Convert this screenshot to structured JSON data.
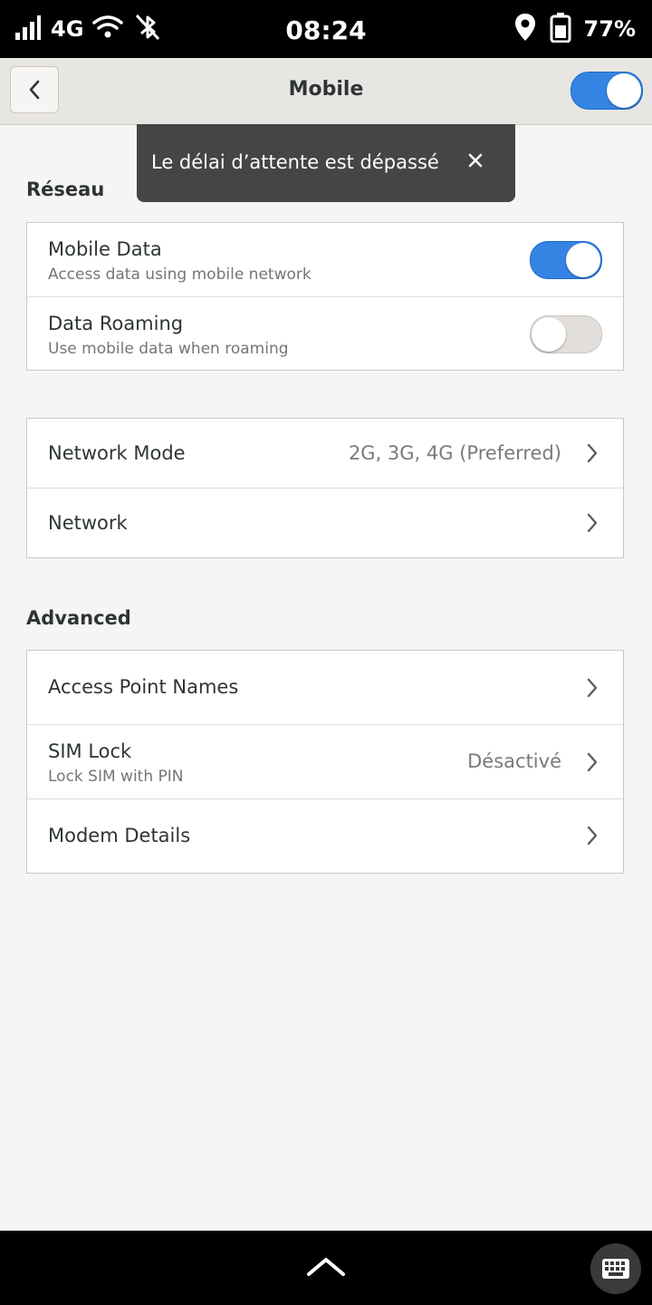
{
  "statusbar": {
    "network_type": "4G",
    "clock": "08:24",
    "battery_percent": "77%",
    "signal_icon": "signal-bars-icon",
    "wifi_icon": "wifi-icon",
    "bluetooth_icon": "bluetooth-disabled-icon",
    "location_icon": "location-pin-icon",
    "battery_icon": "battery-charging-icon"
  },
  "header": {
    "title": "Mobile",
    "back_icon": "chevron-left-icon",
    "master_switch_on": true
  },
  "toast": {
    "message": "Le délai d’attente est dépassé",
    "close_icon": "close-icon"
  },
  "sections": {
    "network_title": "Réseau",
    "advanced_title": "Advanced"
  },
  "network_list": {
    "mobile_data": {
      "title": "Mobile Data",
      "subtitle": "Access data using mobile network",
      "enabled": true
    },
    "data_roaming": {
      "title": "Data Roaming",
      "subtitle": "Use mobile data when roaming",
      "enabled": false
    }
  },
  "mode_list": {
    "network_mode": {
      "title": "Network Mode",
      "value": "2G, 3G, 4G (Preferred)"
    },
    "network": {
      "title": "Network"
    }
  },
  "advanced_list": {
    "apn": {
      "title": "Access Point Names"
    },
    "sim_lock": {
      "title": "SIM Lock",
      "subtitle": "Lock SIM with PIN",
      "value": "Désactivé"
    },
    "modem_details": {
      "title": "Modem Details"
    }
  },
  "bottombar": {
    "up_icon": "chevron-up-icon",
    "keyboard_icon": "keyboard-icon"
  },
  "colors": {
    "accent": "#3584e4",
    "background": "#f6f5f4",
    "header": "#e8e6e3",
    "toast": "#454545"
  }
}
